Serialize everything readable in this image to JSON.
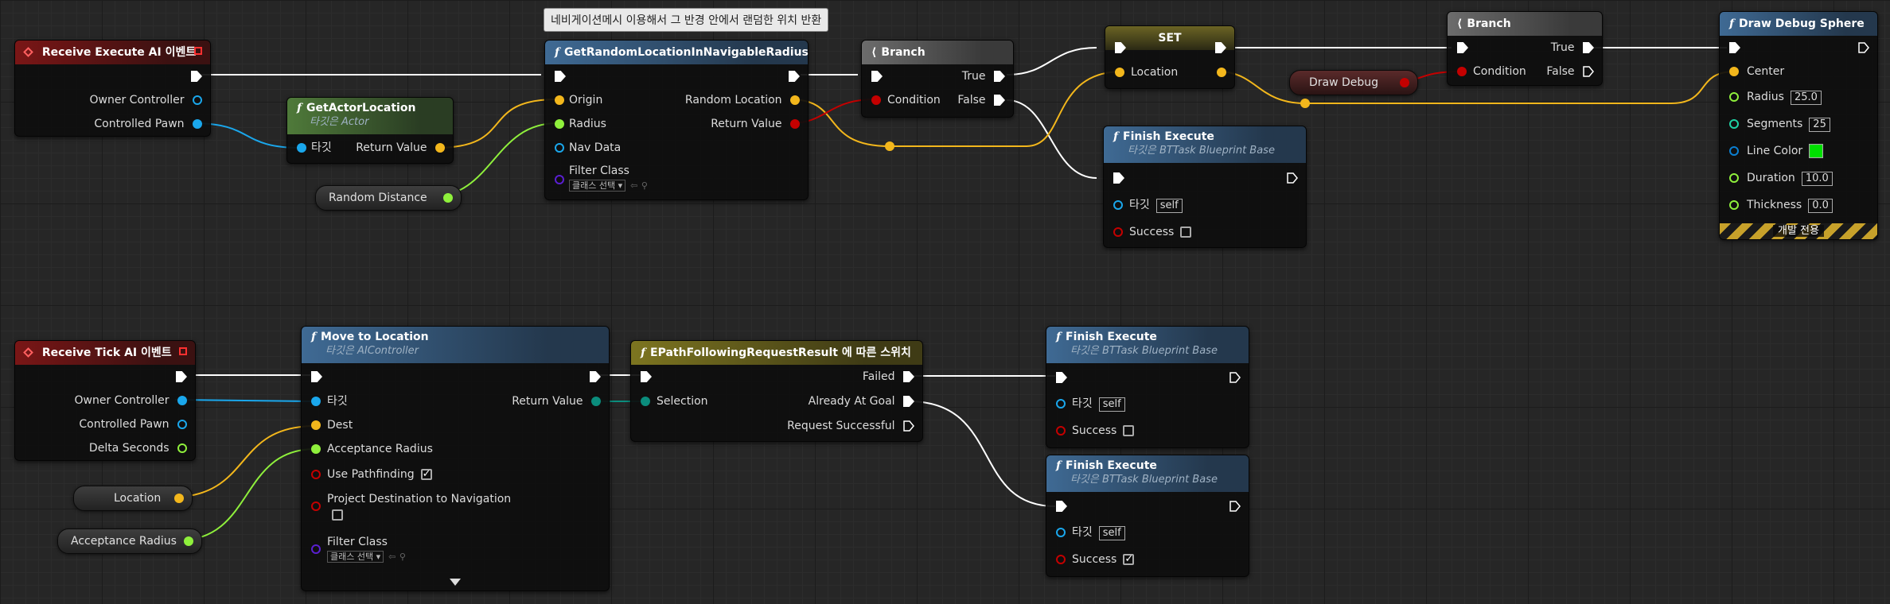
{
  "colors": {
    "exec": "#ffffff",
    "object": "#1aa7ec",
    "vector": "#f3b71c",
    "float": "#8ff03c",
    "bool": "#c40000",
    "class": "#5a1fd1",
    "struct": "#0b8d7d",
    "linecolor_value": "#00e000"
  },
  "tooltip": "네비게이션메시 이용해서 그 반경 안에서 랜덤한 위치 반환",
  "nodes": {
    "receive_execute": {
      "title": "Receive Execute AI 이벤트",
      "pins": [
        "Owner Controller",
        "Controlled Pawn"
      ]
    },
    "get_actor_location": {
      "title": "GetActorLocation",
      "subtitle": "타깃은 Actor",
      "target": "타깃",
      "return": "Return Value"
    },
    "random_distance": {
      "label": "Random Distance"
    },
    "get_random_location": {
      "title": "GetRandomLocationInNavigableRadius",
      "inputs": [
        "Origin",
        "Radius",
        "Nav Data",
        "Filter Class"
      ],
      "class_select": "클래스 선택",
      "outputs": [
        "Random Location",
        "Return Value"
      ]
    },
    "branch1": {
      "title": "Branch",
      "condition": "Condition",
      "true": "True",
      "false": "False"
    },
    "set": {
      "title": "SET",
      "location": "Location"
    },
    "draw_debug_var": {
      "label": "Draw Debug"
    },
    "branch2": {
      "title": "Branch",
      "condition": "Condition",
      "true": "True",
      "false": "False"
    },
    "finish_execute_top": {
      "title": "Finish Execute",
      "subtitle": "타깃은 BTTask Blueprint Base",
      "target": "타깃",
      "target_value": "self",
      "success": "Success",
      "success_checked": false
    },
    "draw_debug_sphere": {
      "title": "Draw Debug Sphere",
      "center": "Center",
      "radius": "Radius",
      "radius_value": "25.0",
      "segments": "Segments",
      "segments_value": "25",
      "line_color": "Line Color",
      "duration": "Duration",
      "duration_value": "10.0",
      "thickness": "Thickness",
      "thickness_value": "0.0",
      "dev_only": "개발 전용"
    },
    "receive_tick": {
      "title": "Receive Tick AI 이벤트",
      "pins": [
        "Owner Controller",
        "Controlled Pawn",
        "Delta Seconds"
      ]
    },
    "location_var": {
      "label": "Location"
    },
    "acceptance_radius_var": {
      "label": "Acceptance Radius"
    },
    "move_to_location": {
      "title": "Move to Location",
      "subtitle": "타깃은 AIController",
      "target": "타깃",
      "dest": "Dest",
      "acceptance_radius": "Acceptance Radius",
      "use_pathfinding": "Use Pathfinding",
      "use_pathfinding_checked": true,
      "project_destination": "Project Destination to Navigation",
      "project_destination_checked": false,
      "filter_class": "Filter Class",
      "class_select": "클래스 선택",
      "return": "Return Value"
    },
    "switch": {
      "title": "EPathFollowingRequestResult 에 따른 스위치",
      "selection": "Selection",
      "outputs": [
        "Failed",
        "Already At Goal",
        "Request Successful"
      ]
    },
    "finish_execute_mid": {
      "title": "Finish Execute",
      "subtitle": "타깃은 BTTask Blueprint Base",
      "target": "타깃",
      "target_value": "self",
      "success": "Success",
      "success_checked": false
    },
    "finish_execute_bot": {
      "title": "Finish Execute",
      "subtitle": "타깃은 BTTask Blueprint Base",
      "target": "타깃",
      "target_value": "self",
      "success": "Success",
      "success_checked": true
    }
  }
}
